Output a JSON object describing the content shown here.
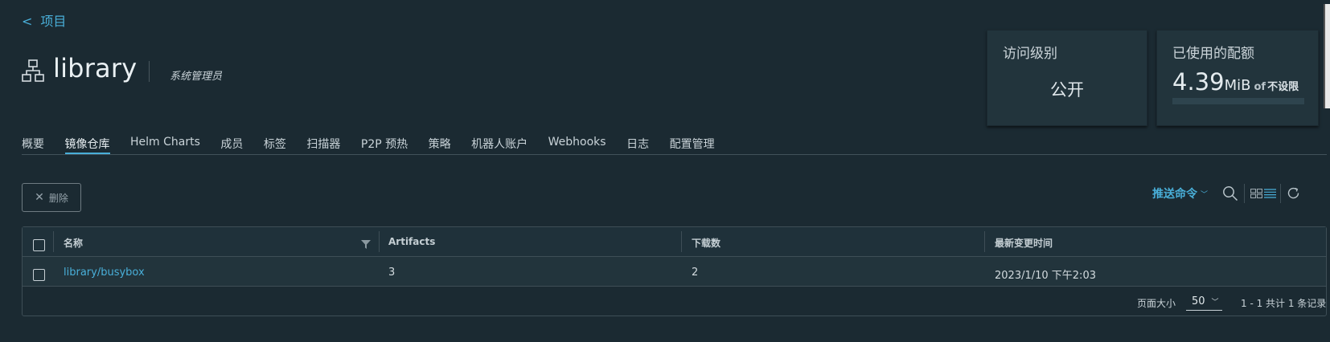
{
  "back": {
    "chevron": "<",
    "label": "项目"
  },
  "project": {
    "name": "library",
    "role": "系统管理员",
    "icon": "project-hierarchy-icon"
  },
  "cards": {
    "access": {
      "title": "访问级别",
      "value": "公开"
    },
    "quota": {
      "title": "已使用的配额",
      "used": "4.39",
      "unit": "MiB",
      "of": "of",
      "limit": "不设限",
      "used_fraction": 0
    }
  },
  "tabs": [
    {
      "label": "概要"
    },
    {
      "label": "镜像仓库",
      "active": true
    },
    {
      "label": "Helm Charts"
    },
    {
      "label": "成员"
    },
    {
      "label": "标签"
    },
    {
      "label": "扫描器"
    },
    {
      "label": "P2P 预热"
    },
    {
      "label": "策略"
    },
    {
      "label": "机器人账户"
    },
    {
      "label": "Webhooks"
    },
    {
      "label": "日志"
    },
    {
      "label": "配置管理"
    }
  ],
  "toolbar": {
    "delete_label": "删除",
    "push_command_label": "推送命令",
    "icons": [
      "search-icon",
      "card-view-icon",
      "list-view-icon",
      "refresh-icon"
    ]
  },
  "table": {
    "columns": [
      "名称",
      "Artifacts",
      "下载数",
      "最新变更时间"
    ],
    "rows": [
      {
        "name": "library/busybox",
        "artifacts": "3",
        "downloads": "2",
        "updated": "2023/1/10 下午2:03"
      }
    ],
    "footer": {
      "page_size_label": "页面大小",
      "page_size": "50",
      "summary": "1 - 1 共计 1 条记录"
    }
  },
  "colors": {
    "background": "#1b2a32",
    "card": "#22343c",
    "accent": "#49afd9",
    "text": "#dbe3e7"
  }
}
